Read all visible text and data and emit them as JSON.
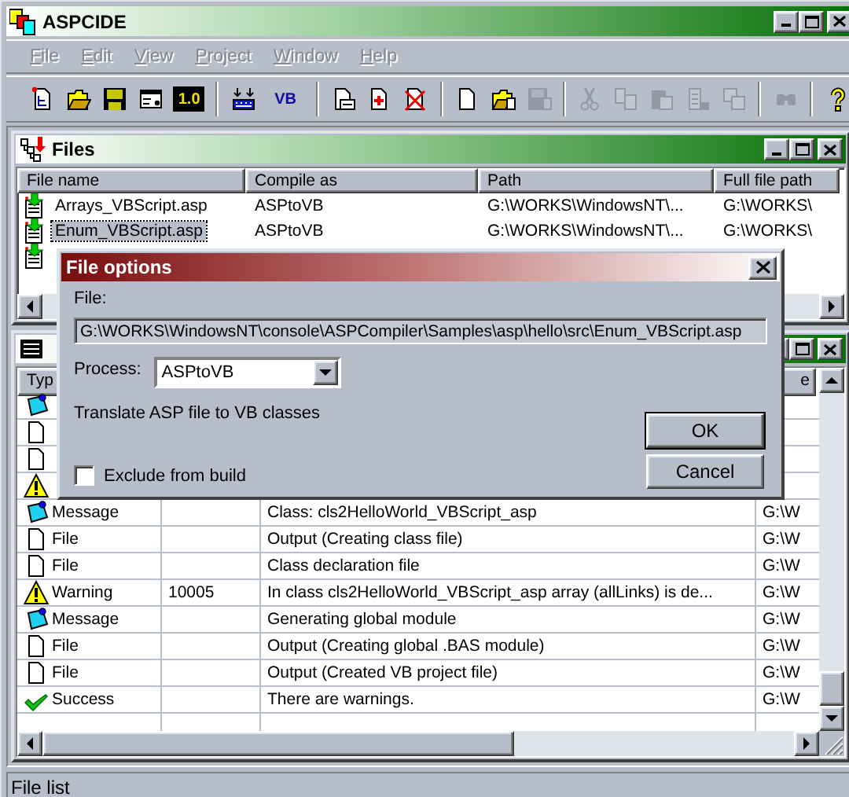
{
  "app": {
    "title": "ASPCIDE"
  },
  "menu": [
    {
      "label": "File",
      "disabled": true
    },
    {
      "label": "Edit",
      "disabled": true
    },
    {
      "label": "View",
      "disabled": true
    },
    {
      "label": "Project",
      "disabled": true
    },
    {
      "label": "Window",
      "disabled": true
    },
    {
      "label": "Help",
      "disabled": true
    }
  ],
  "toolbar": [
    {
      "items": [
        {
          "kind": "new-project",
          "disabled": false
        },
        {
          "kind": "open",
          "disabled": false
        },
        {
          "kind": "save",
          "disabled": false
        },
        {
          "kind": "properties",
          "disabled": false
        },
        {
          "kind": "text",
          "label": "1.0",
          "disabled": false
        }
      ]
    },
    {
      "items": [
        {
          "kind": "build",
          "disabled": false
        },
        {
          "kind": "text-plain",
          "label": "VB",
          "disabled": false
        }
      ]
    },
    {
      "items": [
        {
          "kind": "doc-search",
          "disabled": false
        },
        {
          "kind": "doc-add",
          "disabled": false
        },
        {
          "kind": "doc-remove",
          "disabled": false
        }
      ]
    },
    {
      "items": [
        {
          "kind": "new-file",
          "disabled": false
        },
        {
          "kind": "open-file",
          "disabled": false
        },
        {
          "kind": "save-file",
          "disabled": true
        }
      ]
    },
    {
      "items": [
        {
          "kind": "cut",
          "disabled": true
        },
        {
          "kind": "copy",
          "disabled": true
        },
        {
          "kind": "paste",
          "disabled": true
        },
        {
          "kind": "paste-special",
          "disabled": true
        },
        {
          "kind": "copy-special",
          "disabled": true
        }
      ]
    },
    {
      "items": [
        {
          "kind": "find",
          "disabled": true
        }
      ]
    },
    {
      "items": [
        {
          "kind": "help",
          "disabled": false
        }
      ]
    }
  ],
  "files_panel": {
    "title": "Files",
    "columns": [
      "File name",
      "Compile as",
      "Path",
      "Full file path"
    ],
    "rows": [
      {
        "file_name": "Arrays_VBScript.asp",
        "compile_as": "ASPtoVB",
        "path": "G:\\WORKS\\WindowsNT\\...",
        "full_path": "G:\\WORKS\\",
        "selected": false
      },
      {
        "file_name": "Enum_VBScript.asp",
        "compile_as": "ASPtoVB",
        "path": "G:\\WORKS\\WindowsNT\\...",
        "full_path": "G:\\WORKS\\",
        "selected": true
      },
      {
        "selected": false
      }
    ]
  },
  "output_panel": {
    "columns": [
      {
        "label": "Typ"
      },
      {},
      {},
      {
        "label": "e"
      }
    ],
    "rows": [
      {
        "kind": "message"
      },
      {
        "kind": "file"
      },
      {
        "kind": "file"
      },
      {
        "kind": "warning"
      },
      {
        "kind": "message",
        "type": "Message",
        "description": "Class: cls2HelloWorld_VBScript_asp",
        "path": "G:\\W"
      },
      {
        "kind": "file",
        "type": "File",
        "description": "Output (Creating class file)",
        "path": "G:\\W"
      },
      {
        "kind": "file",
        "type": "File",
        "description": "Class declaration file",
        "path": "G:\\W"
      },
      {
        "kind": "warning",
        "type": "Warning",
        "code": "10005",
        "description": "In class cls2HelloWorld_VBScript_asp array (allLinks) is de...",
        "path": "G:\\W"
      },
      {
        "kind": "message",
        "type": "Message",
        "description": "Generating global module",
        "path": "G:\\W"
      },
      {
        "kind": "file",
        "type": "File",
        "description": "Output (Creating global .BAS module)",
        "path": "G:\\W"
      },
      {
        "kind": "file",
        "type": "File",
        "description": "Output (Created VB project file)",
        "path": "G:\\W"
      },
      {
        "kind": "success",
        "type": "Success",
        "description": "There are warnings.",
        "path": "G:\\W"
      }
    ]
  },
  "dialog": {
    "title": "File options",
    "file_label": "File:",
    "file_value": "G:\\WORKS\\WindowsNT\\console\\ASPCompiler\\Samples\\asp\\hello\\src\\Enum_VBScript.asp",
    "process_label": "Process:",
    "process_value": "ASPtoVB",
    "description": "Translate ASP file to VB classes",
    "exclude": {
      "label": "Exclude from build",
      "checked": false
    },
    "buttons": [
      {
        "label": "OK",
        "default": true
      },
      {
        "label": "Cancel",
        "default": false
      }
    ]
  },
  "status_bar": {
    "text": "File list"
  }
}
